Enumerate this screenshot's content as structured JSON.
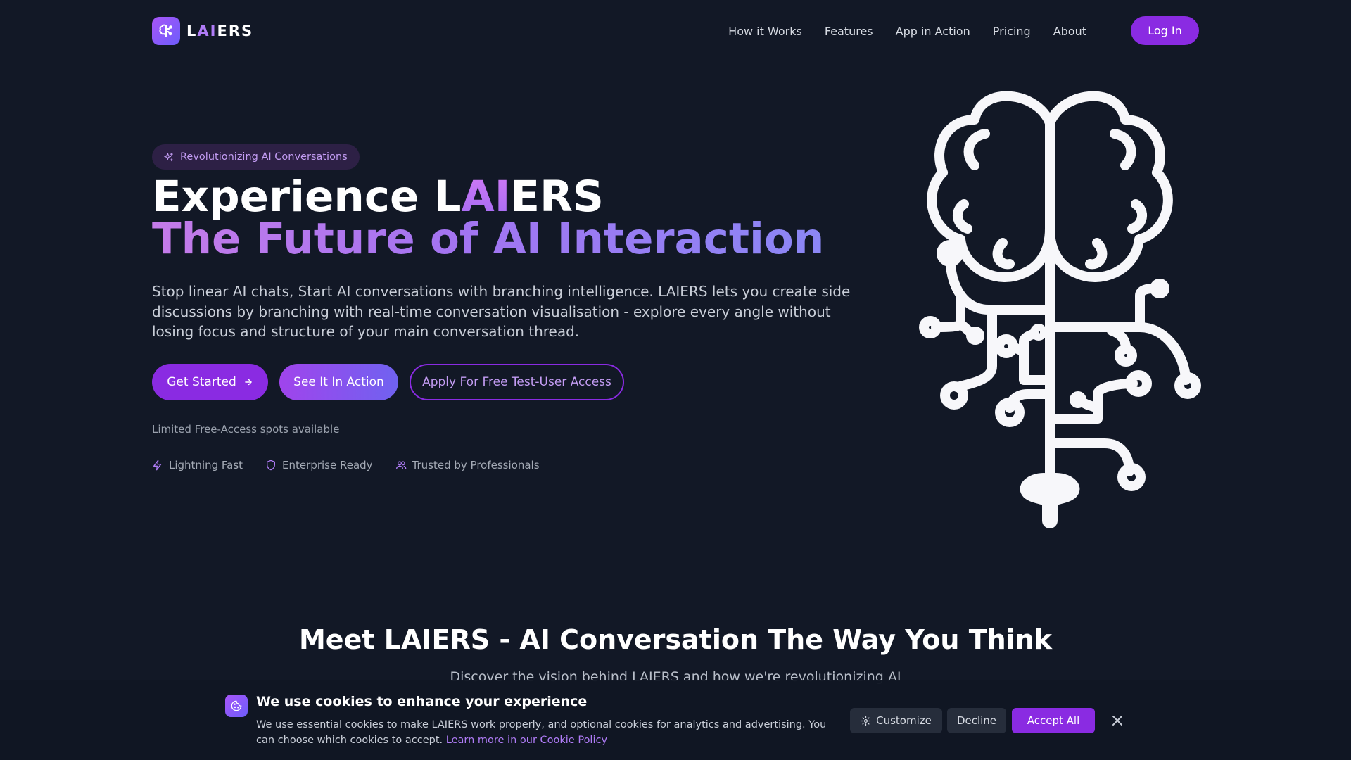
{
  "nav": {
    "logo_prefix": "L",
    "logo_accent": "AI",
    "logo_suffix": "ERS",
    "links": [
      "How it Works",
      "Features",
      "App in Action",
      "Pricing",
      "About"
    ],
    "login_label": "Log In"
  },
  "hero": {
    "badge": "Revolutionizing AI Conversations",
    "headline_prefix": "Experience L",
    "headline_accent": "AI",
    "headline_suffix": "ERS",
    "headline_line2": "The Future of AI Interaction",
    "subtext": "Stop linear AI chats, Start AI conversations with branching intelligence. LAIERS lets you create side discussions by branching with real-time conversation visualisation - explore every angle without losing focus and structure of your main conversation thread.",
    "primary_button": "Get Started",
    "secondary_button": "See It In Action",
    "outline_button": "Apply For Free Test-User Access",
    "limited_note": "Limited Free-Access spots available",
    "features": [
      {
        "icon": "lightning-icon",
        "label": "Lightning Fast"
      },
      {
        "icon": "shield-icon",
        "label": "Enterprise Ready"
      },
      {
        "icon": "users-icon",
        "label": "Trusted by Professionals"
      }
    ]
  },
  "section": {
    "title": "Meet LAIERS - AI Conversation The Way You Think",
    "subtitle": "Discover the vision behind LAIERS and how we're revolutionizing AI"
  },
  "cookie": {
    "title": "We use cookies to enhance your experience",
    "text": "We use essential cookies to make LAIERS work properly, and optional cookies for analytics and advertising. You can choose which cookies to accept.",
    "link": "Learn more in our Cookie Policy",
    "customize": "Customize",
    "decline": "Decline",
    "accept": "Accept All"
  },
  "colors": {
    "background": "#121826",
    "accent": "#8a2be2",
    "accent_light": "#b07cf7",
    "brain": "#f7f7fa"
  }
}
